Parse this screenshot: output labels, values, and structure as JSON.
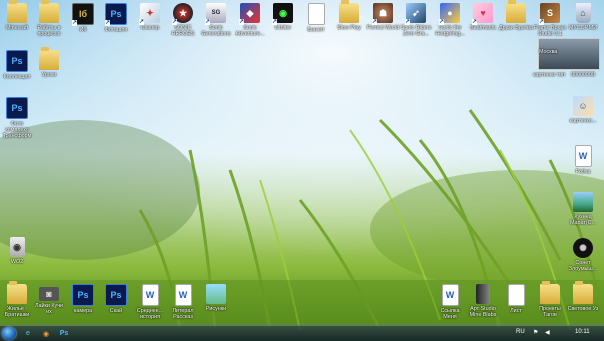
{
  "desktop": {
    "icons": [
      {
        "label": "Minecraft",
        "icon": "folder-icon"
      },
      {
        "label": "Работы в процессе",
        "icon": "folder-icon"
      },
      {
        "label": "Иб",
        "icon": "illustrator-app-icon"
      },
      {
        "label": "Фотошоп",
        "icon": "photoshop-app-icon"
      },
      {
        "label": "Сканер",
        "icon": "scanner-app-icon"
      },
      {
        "label": "SONIC HEROES",
        "icon": "sonic-heroes-game-icon"
      },
      {
        "label": "Sonic Generations",
        "icon": "sonic-generations-game-icon"
      },
      {
        "label": "Sonic Adventure...",
        "icon": "sonic-adventure-game-icon"
      },
      {
        "label": "Orbiter",
        "icon": "orbiter-game-icon"
      },
      {
        "label": "Банкет",
        "icon": "blank-document-icon"
      },
      {
        "label": "Slow Play",
        "icon": "folder-icon"
      },
      {
        "label": "Perfect World",
        "icon": "perfect-world-game-icon"
      },
      {
        "label": "Sonic Riders Zero Gra...",
        "icon": "sonic-riders-game-icon"
      },
      {
        "label": "Sonic the Hedgehog...",
        "icon": "sonic-hedgehog-game-icon"
      },
      {
        "label": "Beatmania",
        "icon": "anime-game-icon"
      },
      {
        "label": "Друзи Братва",
        "icon": "folder-icon"
      },
      {
        "label": "Frame Boxes Studio 3.1",
        "icon": "studio-app-icon"
      },
      {
        "label": "МУСОР.МИ",
        "icon": "recycle-bin-icon"
      },
      {
        "label": "Коллекция",
        "icon": "photoshop-file-icon"
      },
      {
        "label": "Уроки",
        "icon": "folder-icon"
      },
      {
        "label": "Фото комплекс Трансформ",
        "icon": "photoshop-file-icon"
      },
      {
        "label": "Москва",
        "icon": "photo-thumbnail-icon"
      },
      {
        "label": "картинки тип",
        "icon": "photo-thumbnail-icon"
      },
      {
        "label": "00000008",
        "icon": "photo-thumbnail-icon"
      },
      {
        "label": "картинки...",
        "icon": "anime-image-icon"
      },
      {
        "label": "Poliva",
        "icon": "word-document-icon"
      },
      {
        "label": "Кузнец Марат(С...",
        "icon": "landscape-image-icon"
      },
      {
        "label": "Сонет Злоумыш...",
        "icon": "dark-image-icon"
      },
      {
        "label": "WO2",
        "icon": "audio-file-icon"
      },
      {
        "label": "Жильё - Братишки",
        "icon": "folder-icon"
      },
      {
        "label": "Лайки Кучи их",
        "icon": "camera-icon"
      },
      {
        "label": "камера",
        "icon": "photoshop-file-icon"
      },
      {
        "label": "Скай",
        "icon": "photoshop-file-icon"
      },
      {
        "label": "Среднее... история",
        "icon": "word-document-icon"
      },
      {
        "label": "Литерал Рассказ",
        "icon": "word-document-icon"
      },
      {
        "label": "Рисунки",
        "icon": "image-file-icon"
      },
      {
        "label": "Ссылка Меня",
        "icon": "word-document-icon"
      },
      {
        "label": "Арт Studio Mine Blabs",
        "icon": "dark-app-icon"
      },
      {
        "label": "Лист",
        "icon": "blank-document-icon"
      },
      {
        "label": "Проекты Тагов",
        "icon": "folder-icon"
      },
      {
        "label": "Световое Уз",
        "icon": "folder-icon"
      }
    ]
  },
  "taskbar": {
    "language": "RU",
    "clock": "10:11",
    "pinned": [
      {
        "name": "ie-icon"
      },
      {
        "name": "firefox-icon"
      },
      {
        "name": "photoshop-icon"
      }
    ]
  }
}
